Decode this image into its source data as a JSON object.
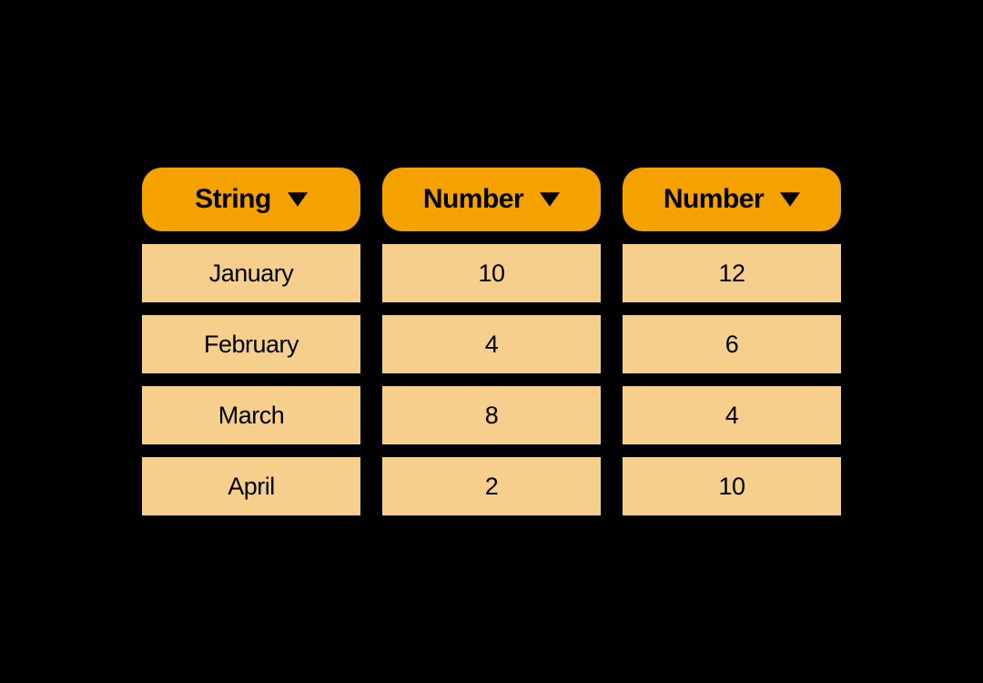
{
  "columns": [
    {
      "header": "String",
      "values": [
        "January",
        "February",
        "March",
        "April"
      ]
    },
    {
      "header": "Number",
      "values": [
        "10",
        "4",
        "8",
        "2"
      ]
    },
    {
      "header": "Number",
      "values": [
        "12",
        "6",
        "4",
        "10"
      ]
    }
  ],
  "chart_data": {
    "type": "table",
    "title": "",
    "categories": [
      "January",
      "February",
      "March",
      "April"
    ],
    "series": [
      {
        "name": "Number",
        "values": [
          10,
          4,
          8,
          2
        ]
      },
      {
        "name": "Number",
        "values": [
          12,
          6,
          4,
          10
        ]
      }
    ]
  }
}
